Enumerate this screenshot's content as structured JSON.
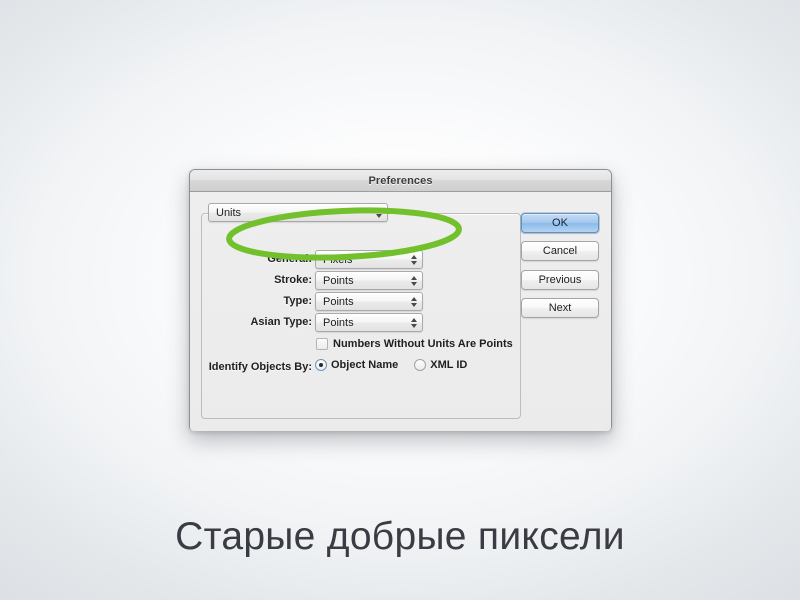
{
  "caption": "Старые добрые пиксели",
  "colors": {
    "highlight_green": "#72c02c",
    "default_button_blue": "#a6c9ee",
    "background_edge": "#dfe3e6",
    "background_center": "#ffffff"
  },
  "dialog": {
    "title": "Preferences",
    "panel_selector": {
      "name": "units-panel-select",
      "value": "Units"
    },
    "rows": [
      {
        "label": "General:",
        "value": "Pixels"
      },
      {
        "label": "Stroke:",
        "value": "Points"
      },
      {
        "label": "Type:",
        "value": "Points"
      },
      {
        "label": "Asian Type:",
        "value": "Points"
      }
    ],
    "checkbox": {
      "label": "Numbers Without Units Are Points",
      "checked": false
    },
    "identify": {
      "label": "Identify Objects By:",
      "options": [
        {
          "label": "Object Name",
          "selected": true
        },
        {
          "label": "XML ID",
          "selected": false
        }
      ]
    },
    "buttons": [
      {
        "label": "OK",
        "default": true
      },
      {
        "label": "Cancel",
        "default": false
      },
      {
        "label": "Previous",
        "default": false
      },
      {
        "label": "Next",
        "default": false
      }
    ]
  }
}
